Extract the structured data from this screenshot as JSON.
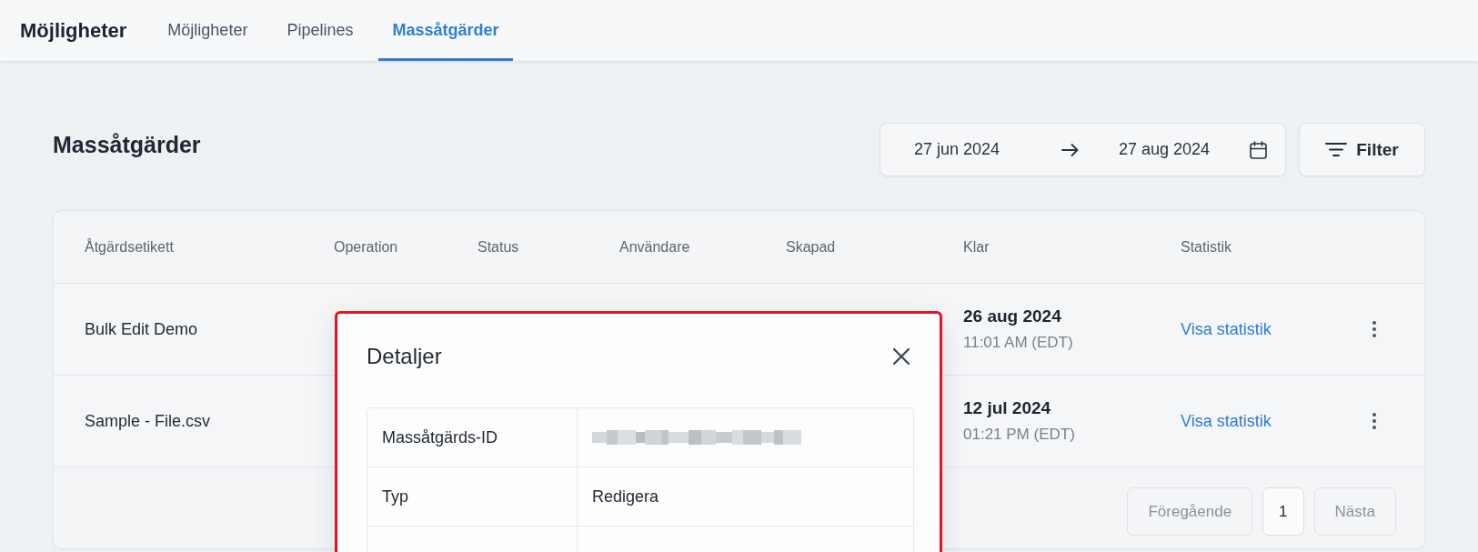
{
  "top_nav": {
    "title": "Möjligheter",
    "tabs": [
      {
        "label": "Möjligheter",
        "selected": false
      },
      {
        "label": "Pipelines",
        "selected": false
      },
      {
        "label": "Massåtgärder",
        "selected": true
      }
    ]
  },
  "page": {
    "title": "Massåtgärder",
    "date_range": {
      "start": "27 jun 2024",
      "end": "27 aug 2024"
    },
    "filter_button": {
      "label": "Filter"
    }
  },
  "table": {
    "columns": [
      "Åtgärdsetikett",
      "Operation",
      "Status",
      "Användare",
      "Skapad",
      "Klar",
      "Statistik"
    ],
    "rows": [
      {
        "label": "Bulk Edit Demo",
        "completed_date": "26 aug 2024",
        "completed_time": "11:01 AM (EDT)",
        "stats_link": "Visa statistik"
      },
      {
        "label": "Sample - File.csv",
        "completed_date": "12 jul 2024",
        "completed_time": "01:21 PM (EDT)",
        "stats_link": "Visa statistik"
      }
    ]
  },
  "pagination": {
    "previous": {
      "label": "Föregående",
      "disabled": true
    },
    "pages": [
      {
        "label": "1",
        "selected": true
      }
    ],
    "next": {
      "label": "Nästa",
      "disabled": true
    }
  },
  "modal": {
    "title": "Detaljer",
    "rows": [
      {
        "kind": "redacted",
        "label": "Massåtgärds-ID"
      },
      {
        "kind": "text",
        "label": "Typ",
        "value": "Redigera"
      }
    ]
  }
}
